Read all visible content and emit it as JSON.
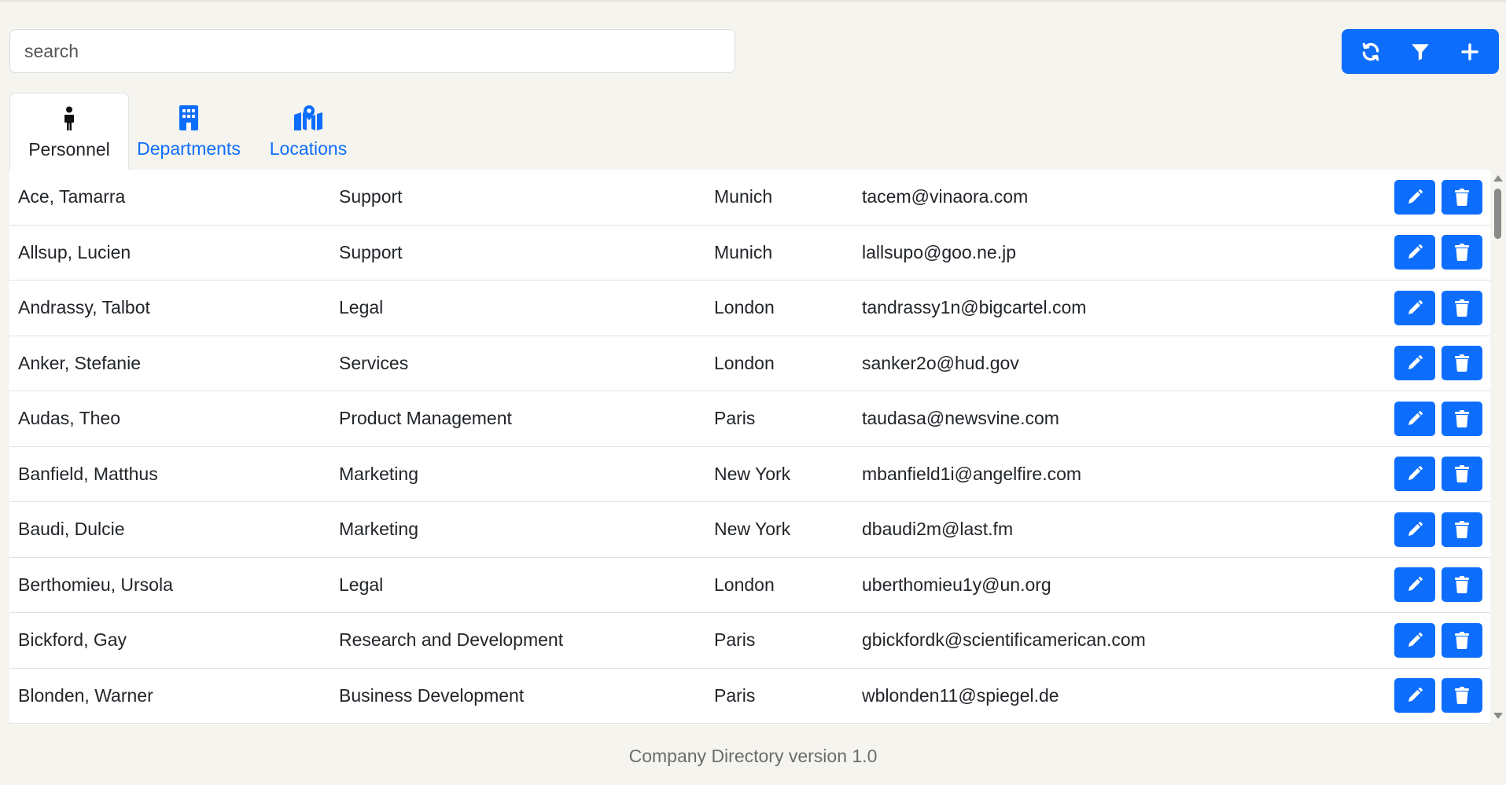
{
  "search": {
    "placeholder": "search",
    "value": ""
  },
  "toolbar": {
    "refresh_icon": "refresh-icon",
    "filter_icon": "filter-icon",
    "add_icon": "plus-icon"
  },
  "tabs": [
    {
      "label": "Personnel",
      "icon": "person-icon",
      "active": true
    },
    {
      "label": "Departments",
      "icon": "building-icon",
      "active": false
    },
    {
      "label": "Locations",
      "icon": "map-location-icon",
      "active": false
    }
  ],
  "personnel": [
    {
      "name": "Ace, Tamarra",
      "department": "Support",
      "location": "Munich",
      "email": "tacem@vinaora.com"
    },
    {
      "name": "Allsup, Lucien",
      "department": "Support",
      "location": "Munich",
      "email": "lallsupo@goo.ne.jp"
    },
    {
      "name": "Andrassy, Talbot",
      "department": "Legal",
      "location": "London",
      "email": "tandrassy1n@bigcartel.com"
    },
    {
      "name": "Anker, Stefanie",
      "department": "Services",
      "location": "London",
      "email": "sanker2o@hud.gov"
    },
    {
      "name": "Audas, Theo",
      "department": "Product Management",
      "location": "Paris",
      "email": "taudasa@newsvine.com"
    },
    {
      "name": "Banfield, Matthus",
      "department": "Marketing",
      "location": "New York",
      "email": "mbanfield1i@angelfire.com"
    },
    {
      "name": "Baudi, Dulcie",
      "department": "Marketing",
      "location": "New York",
      "email": "dbaudi2m@last.fm"
    },
    {
      "name": "Berthomieu, Ursola",
      "department": "Legal",
      "location": "London",
      "email": "uberthomieu1y@un.org"
    },
    {
      "name": "Bickford, Gay",
      "department": "Research and Development",
      "location": "Paris",
      "email": "gbickfordk@scientificamerican.com"
    },
    {
      "name": "Blonden, Warner",
      "department": "Business Development",
      "location": "Paris",
      "email": "wblonden11@spiegel.de"
    }
  ],
  "row_actions": {
    "edit_icon": "pencil-icon",
    "delete_icon": "trash-icon"
  },
  "colors": {
    "accent": "#0d6efd",
    "background": "#f6f4ef"
  },
  "footer": {
    "text": "Company Directory version 1.0"
  }
}
